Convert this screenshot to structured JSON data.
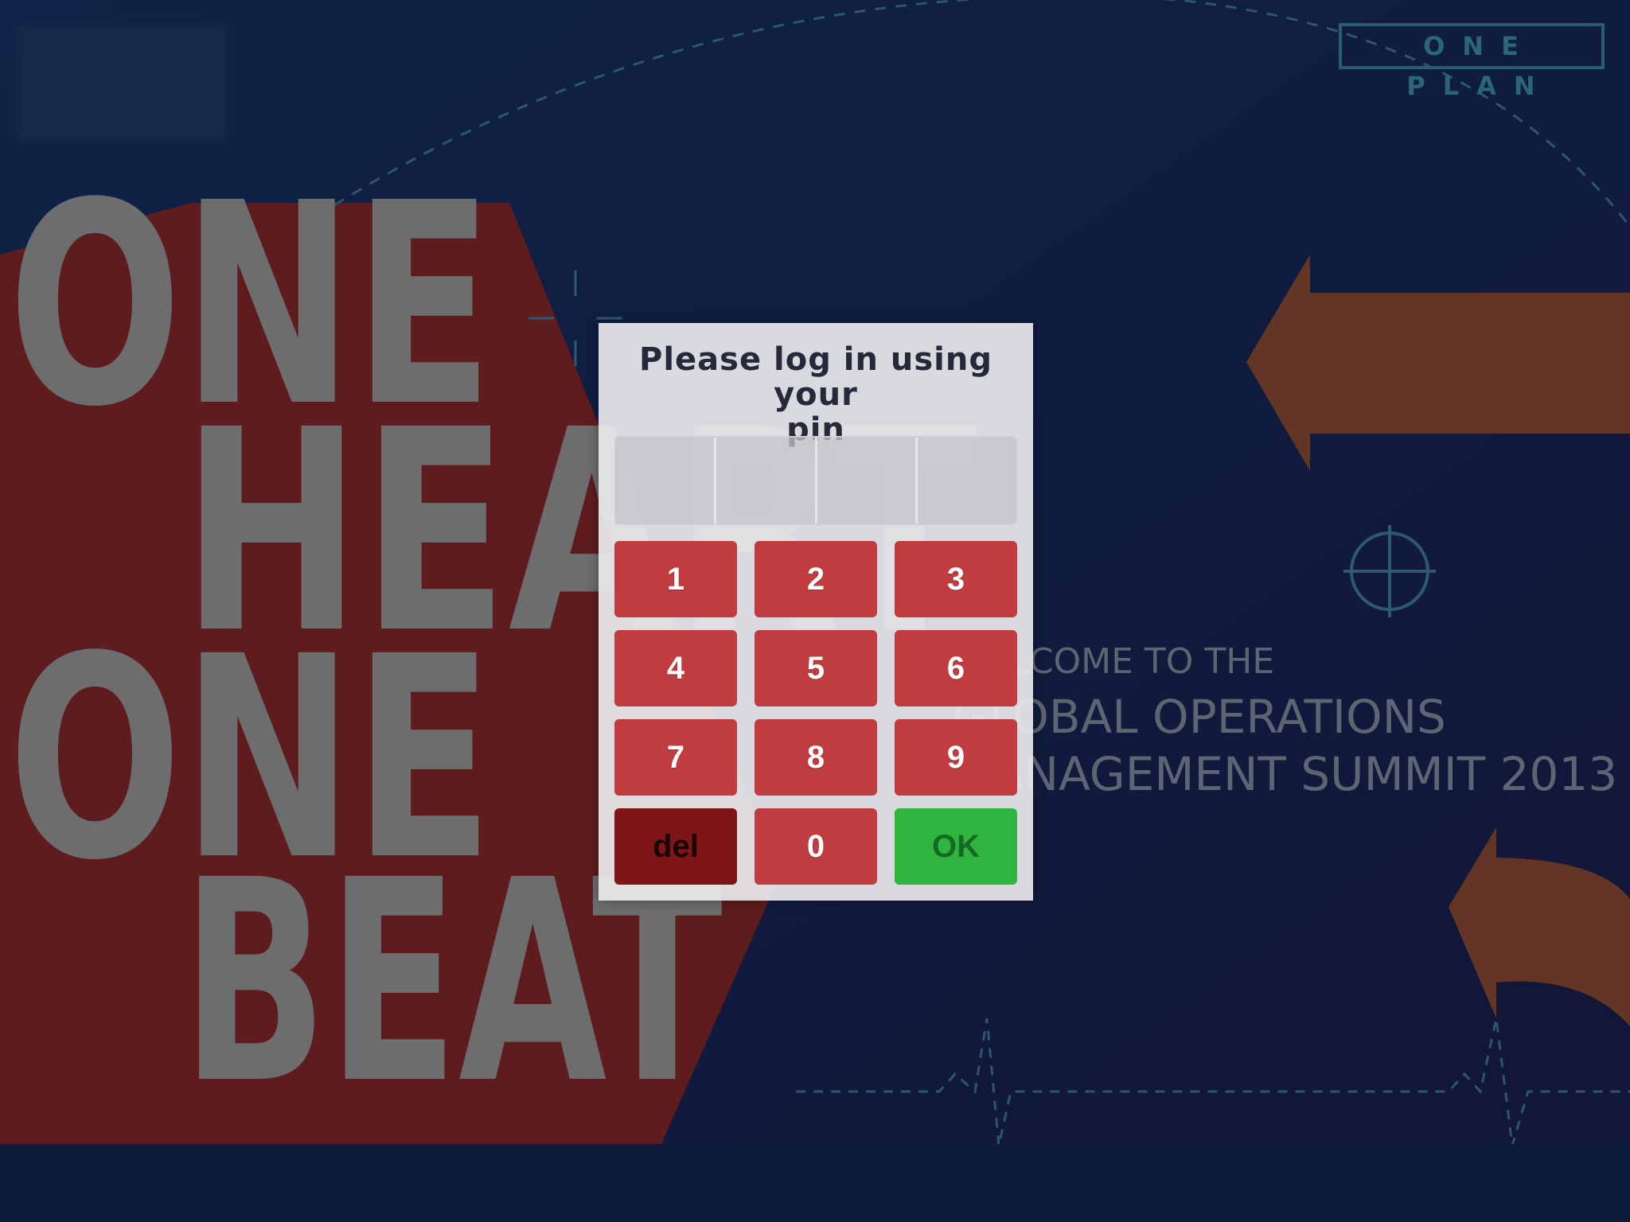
{
  "background": {
    "slogan_lines": [
      "ONE",
      "HEART",
      "ONE",
      "BEAT"
    ],
    "brand_box": "ONE PLAN",
    "welcome_lines": [
      "WELCOME TO THE",
      "GLOBAL OPERATIONS",
      "MANAGEMENT SUMMIT 2013"
    ]
  },
  "dialog": {
    "title_line1": "Please log in using your",
    "title_line2": "pin",
    "pin_digits": [
      "",
      "",
      "",
      ""
    ]
  },
  "keypad": {
    "keys": [
      "1",
      "2",
      "3",
      "4",
      "5",
      "6",
      "7",
      "8",
      "9",
      "del",
      "0",
      "OK"
    ]
  },
  "colors": {
    "background_navy": "#0c1a36",
    "slogan_panel_red": "#5e1c1e",
    "arrow_orange": "#623524",
    "key_red": "#c03c3f",
    "del_dark_red": "#7e1516",
    "ok_green": "#31b541"
  }
}
